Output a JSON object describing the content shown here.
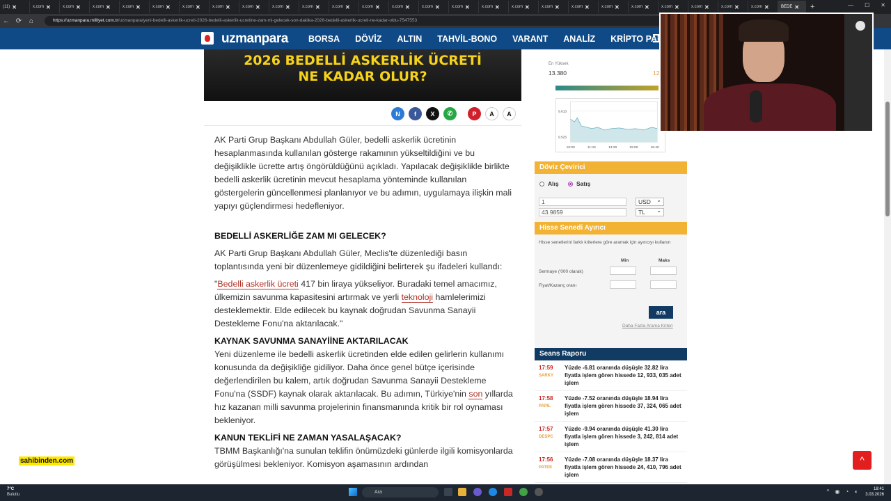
{
  "browser": {
    "tabs": [
      {
        "label": "(11)"
      },
      {
        "label": "x.com"
      },
      {
        "label": "x.com"
      },
      {
        "label": "x.com"
      },
      {
        "label": "x.com"
      },
      {
        "label": "x.com"
      },
      {
        "label": "x.com"
      },
      {
        "label": "x.com"
      },
      {
        "label": "x.com"
      },
      {
        "label": "x.com"
      },
      {
        "label": "x.com"
      },
      {
        "label": "x.com"
      },
      {
        "label": "x.com"
      },
      {
        "label": "x.com"
      },
      {
        "label": "x.com"
      },
      {
        "label": "x.com"
      },
      {
        "label": "x.com"
      },
      {
        "label": "x.com"
      },
      {
        "label": "x.com"
      },
      {
        "label": "x.com"
      },
      {
        "label": "x.com"
      },
      {
        "label": "x.com"
      },
      {
        "label": "x.com"
      },
      {
        "label": "x.com"
      },
      {
        "label": "x.com"
      },
      {
        "label": "x.com"
      },
      {
        "label": "BEDE"
      }
    ],
    "url_host": "https://uzmanpara.milliyet.com.tr",
    "url_path": "/uzmanpara/yeni-bedelli-askerlik-ucreti-2026-bedelli-askerlik-ucretine-zam-mi-gelecek-son-dakika-2026-bedelli-askerlik-ucreti-ne-kadar-oldu-7547553"
  },
  "site": {
    "logo_text": "uzmanpara",
    "nav": [
      "BORSA",
      "DÖVİZ",
      "ALTIN",
      "TAHVİL-BONO",
      "VARANT",
      "ANALİZ",
      "KRİPTO PARA"
    ]
  },
  "hero": {
    "line1": "2026 BEDELLİ ASKERLİK ÜCRETİ",
    "line2": "NE KADAR OLUR?"
  },
  "share": {
    "font_up": "A",
    "font_down": "A"
  },
  "article": {
    "p1": "AK Parti Grup Başkanı Abdullah Güler, bedelli askerlik ücretinin hesaplanmasında kullanılan gösterge rakamının yükseltildiğini ve bu değişiklikle ücrette artış öngörüldüğünü açıkladı. Yapılacak değişiklikle birlikte bedelli askerlik ücretinin mevcut hesaplama yönteminde kullanılan göstergelerin güncellenmesi planlanıyor ve bu adımın, uygulamaya ilişkin mali yapıyı güçlendirmesi hedefleniyor.",
    "h1": "BEDELLİ ASKERLİĞE ZAM MI GELECEK?",
    "p2": "AK Parti Grup Başkanı Abdullah Güler, Meclis'te düzenlediği basın toplantısında yeni bir düzenlemeye gidildiğini belirterek şu ifadeleri kullandı:",
    "q_open": "\"",
    "q_link1": "Bedelli askerlik ücreti",
    "q_mid": " 417 bin liraya yükseliyor. Buradaki temel amacımız, ülkemizin savunma kapasitesini artırmak ve yerli ",
    "q_link2": "teknoloji",
    "q_end": " hamlelerimizi desteklemektir. Elde edilecek bu kaynak doğrudan Savunma Sanayii Destekleme Fonu'na aktarılacak.\"",
    "h2": "KAYNAK SAVUNMA SANAYİİNE AKTARILACAK",
    "p3a": "Yeni düzenleme ile bedelli askerlik ücretinden elde edilen gelirlerin kullanımı konusunda da değişikliğe gidiliyor. Daha önce genel bütçe içerisinde değerlendirilen bu kalem, artık doğrudan Savunma Sanayii Destekleme Fonu'na (SSDF) kaynak olarak aktarılacak. Bu adımın, Türkiye'nin ",
    "p3_link": "son",
    "p3b": " yıllarda hız kazanan milli savunma projelerinin finansmanında kritik bir rol oynaması bekleniyor.",
    "h3": "KANUN TEKLİFİ NE ZAMAN YASALAŞACAK?",
    "p4": "TBMM Başkanlığı'na sunulan teklifin önümüzdeki günlerde ilgili komisyonlarda görüşülmesi bekleniyor. Komisyon aşamasının ardından"
  },
  "rate_box": {
    "label": "En Yüksek",
    "value": "13.380",
    "value_partial": "12",
    "chart_y_ticks": [
      "9.613",
      "9.525"
    ],
    "chart_x_ticks": [
      "10:00",
      "11:40",
      "13:20",
      "15:00",
      "16:40"
    ]
  },
  "converter": {
    "title": "Döviz Çevirici",
    "buy_label": "Alış",
    "sell_label": "Satış",
    "amount": "1",
    "result": "43.9859",
    "from_currency": "USD",
    "to_currency": "TL"
  },
  "stock_filter": {
    "title": "Hisse Senedi Ayırıcı",
    "desc": "Hisse senetlerini farklı kriterlere göre aramak için ayırıcıyı kullanın",
    "col_min": "Min",
    "col_max": "Maks",
    "row1": "Sermaye ('000 olarak)",
    "row2": "Fiyat/Kazanç oranı",
    "search_button": "ara",
    "more_link": "Daha Fazla Arama Kriteri"
  },
  "session_report": {
    "title": "Seans Raporu",
    "items": [
      {
        "time": "17:59",
        "code": "SARKY",
        "text": "Yüzde -6.81 oranında düşüşle 32.82 lira fiyatla işlem gören hissede 12, 933, 035 adet işlem"
      },
      {
        "time": "17:58",
        "code": "PAPIL",
        "text": "Yüzde -7.52 oranında düşüşle 18.94 lira fiyatla işlem gören hissede 37, 324, 065 adet işlem"
      },
      {
        "time": "17:57",
        "code": "DESPC",
        "text": "Yüzde -9.94 oranında düşüşle 41.30 lira fiyatla işlem gören hissede 3, 242, 814 adet işlem"
      },
      {
        "time": "17:56",
        "code": "PATEK",
        "text": "Yüzde -7.08 oranında düşüşle 18.37 lira fiyatla işlem gören hissede 24, 410, 796 adet işlem"
      }
    ]
  },
  "overlay": {
    "sahibinden": "sahibinden.com",
    "scroll_top": "^"
  },
  "taskbar": {
    "weather_temp": "7°C",
    "weather_desc": "Bulutlu",
    "search_placeholder": "Ara",
    "time": "18:41",
    "date": "3.03.2026"
  }
}
